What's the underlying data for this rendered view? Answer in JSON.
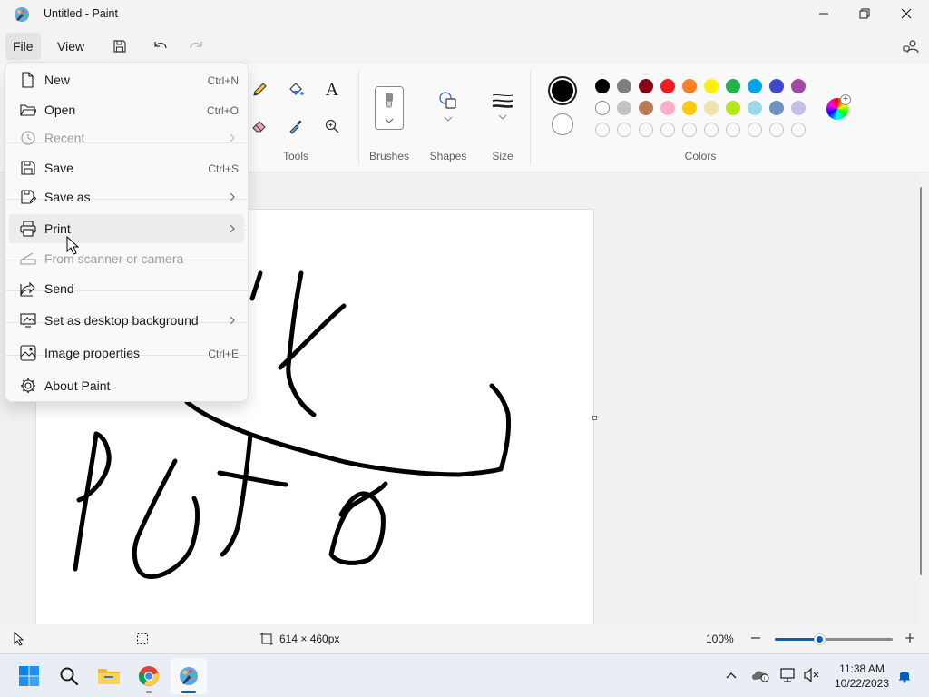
{
  "window": {
    "title": "Untitled - Paint",
    "controls": [
      "minimize",
      "restore",
      "close"
    ]
  },
  "menubar": {
    "file": "File",
    "view": "View",
    "icons": [
      "save-icon",
      "undo-icon",
      "redo-icon",
      "share-account-icon"
    ]
  },
  "file_menu": {
    "items": [
      {
        "label": "New",
        "shortcut": "Ctrl+N",
        "icon": "new-file-icon",
        "enabled": true
      },
      {
        "label": "Open",
        "shortcut": "Ctrl+O",
        "icon": "open-folder-icon",
        "enabled": true
      },
      {
        "label": "Recent",
        "submenu": true,
        "icon": "clock-icon",
        "enabled": false
      },
      {
        "label": "Save",
        "shortcut": "Ctrl+S",
        "icon": "save-icon",
        "enabled": true
      },
      {
        "label": "Save as",
        "submenu": true,
        "icon": "save-as-icon",
        "enabled": true
      },
      {
        "label": "Print",
        "submenu": true,
        "icon": "printer-icon",
        "enabled": true,
        "hovered": true
      },
      {
        "label": "From scanner or camera",
        "icon": "scanner-icon",
        "enabled": false
      },
      {
        "label": "Send",
        "icon": "share-icon",
        "enabled": true
      },
      {
        "label": "Set as desktop background",
        "submenu": true,
        "icon": "desktop-background-icon",
        "enabled": true
      },
      {
        "label": "Image properties",
        "shortcut": "Ctrl+E",
        "icon": "image-properties-icon",
        "enabled": true
      },
      {
        "label": "About Paint",
        "icon": "gear-icon",
        "enabled": true
      }
    ]
  },
  "ribbon": {
    "groups": {
      "tools": "Tools",
      "brushes": "Brushes",
      "shapes": "Shapes",
      "size": "Size",
      "colors": "Colors"
    },
    "tools": [
      "pencil-icon",
      "fill-bucket-icon",
      "text-icon",
      "eraser-icon",
      "color-picker-icon",
      "magnifier-icon"
    ],
    "text_tool_glyph": "A",
    "color1": "#000000",
    "color2": "#ffffff",
    "palette": [
      [
        "#000000",
        "#7f7f7f",
        "#880015",
        "#ed1c24",
        "#ff7f27",
        "#fff200",
        "#22b14c",
        "#00a2e8",
        "#3f48cc",
        "#a349a4"
      ],
      [
        "#ffffff",
        "#c3c3c3",
        "#b97a57",
        "#ffaec9",
        "#ffc90e",
        "#efe4b0",
        "#b5e61d",
        "#99d9ea",
        "#7092be",
        "#c8bfe7"
      ],
      [
        "",
        "",
        "",
        "",
        "",
        "",
        "",
        "",
        "",
        ""
      ]
    ]
  },
  "status": {
    "image_size": "614 × 460px",
    "zoom": "100%",
    "zoom_level_fraction": 0.38
  },
  "taskbar": {
    "apps": [
      "windows-start-icon",
      "search-icon",
      "file-explorer-icon",
      "chrome-icon",
      "paint-icon"
    ],
    "time": "11:38 AM",
    "date": "10/22/2023"
  }
}
